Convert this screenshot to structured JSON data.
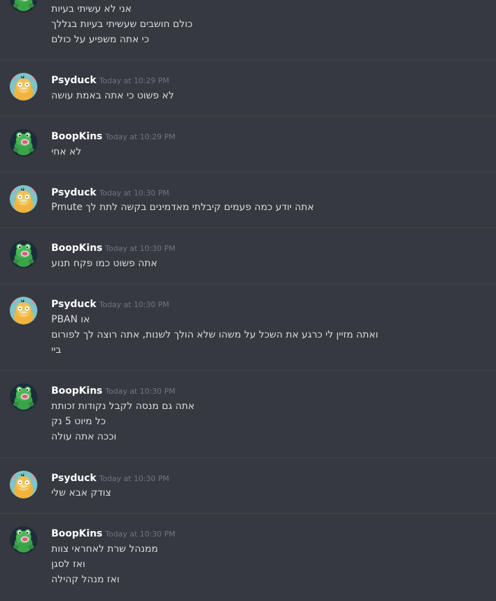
{
  "messages": [
    {
      "author": "",
      "timestamp": "",
      "avatar": "frog-icon",
      "lines": [
        "אני לא עשיתי בעיות",
        "כולם חושבים שעשיתי בעיות בגללך",
        "כי אתה משפיע על כולם"
      ]
    },
    {
      "author": "Psyduck",
      "timestamp": "Today at 10:29 PM",
      "avatar": "duck-icon",
      "lines": [
        "לא פשוט כי אתה באמת עושה"
      ]
    },
    {
      "author": "BoopKins",
      "timestamp": "Today at 10:29 PM",
      "avatar": "frog-icon",
      "lines": [
        "לא אחי"
      ]
    },
    {
      "author": "Psyduck",
      "timestamp": "Today at 10:30 PM",
      "avatar": "duck-icon",
      "lines": [
        "אתה יודע כמה פעמים קיבלתי מאדמינים בקשה לתת לך Pmute"
      ]
    },
    {
      "author": "BoopKins",
      "timestamp": "Today at 10:30 PM",
      "avatar": "frog-icon",
      "lines": [
        "אתה פשוט כמו פקח תנוע"
      ]
    },
    {
      "author": "Psyduck",
      "timestamp": "Today at 10:30 PM",
      "avatar": "duck-icon",
      "lines": [
        "או PBAN",
        "ואתה מזיין לי כרגע את השכל על משהו שלא הולך לשנות, אתה רוצה לך לפורום",
        "ביי"
      ]
    },
    {
      "author": "BoopKins",
      "timestamp": "Today at 10:30 PM",
      "avatar": "frog-icon",
      "lines": [
        "אתה גם מנסה לקבל נקודות זכותת",
        "כל מיוט 5 נק",
        "וככה אתה עולה"
      ]
    },
    {
      "author": "Psyduck",
      "timestamp": "Today at 10:30 PM",
      "avatar": "duck-icon",
      "lines": [
        "צודק אבא שלי"
      ]
    },
    {
      "author": "BoopKins",
      "timestamp": "Today at 10:30 PM",
      "avatar": "frog-icon",
      "lines": [
        "ממנהל שרת לאחראי צוות",
        "ואז לסגן",
        "ואז מנהל קהילה"
      ]
    }
  ]
}
